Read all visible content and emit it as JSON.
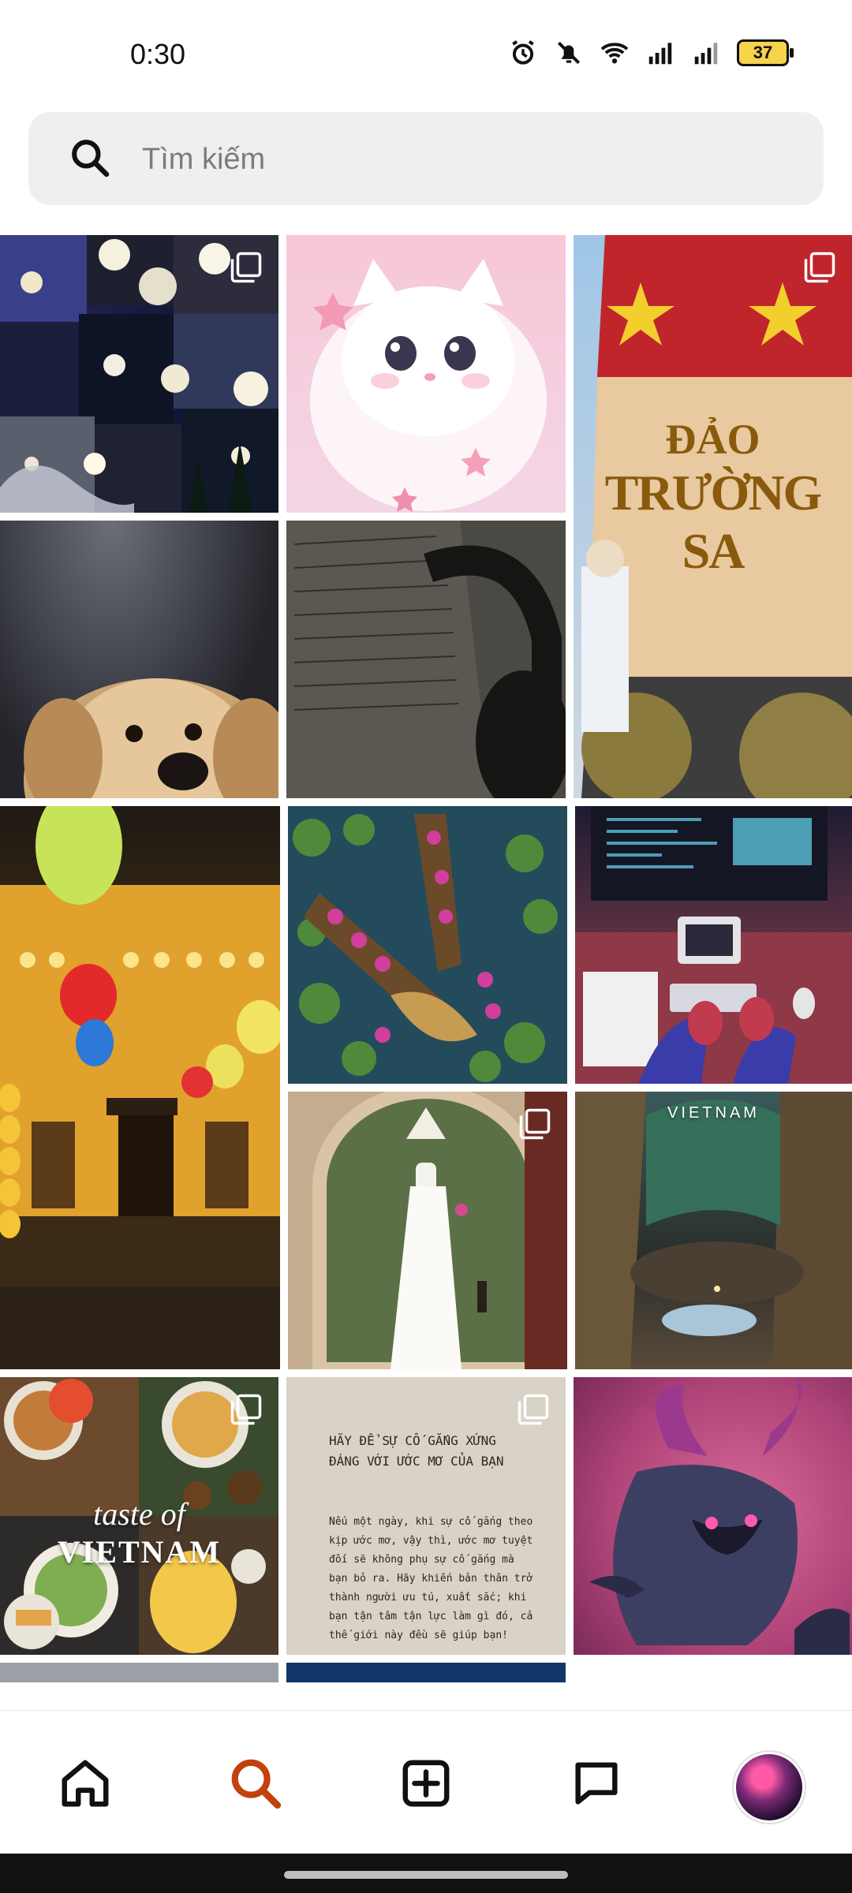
{
  "status": {
    "time": "0:30",
    "battery": "37",
    "icons": [
      "alarm-icon",
      "mute-icon",
      "wifi-icon",
      "signal-icon",
      "signal-icon-2",
      "battery-icon"
    ]
  },
  "search": {
    "placeholder": "Tìm kiếm",
    "icon": "search-icon"
  },
  "grid": {
    "tiles": [
      {
        "name": "moon-collage",
        "multi": true
      },
      {
        "name": "white-kitten-art",
        "multi": false
      },
      {
        "name": "truong-sa-monument",
        "multi": true,
        "text_main": "ĐẢO",
        "text_sub": "TRƯỜNG SA"
      },
      {
        "name": "golden-puppy",
        "multi": false
      },
      {
        "name": "book-headphones",
        "multi": false
      },
      {
        "name": "hoi-an-lanterns",
        "multi": false
      },
      {
        "name": "lotus-boats",
        "multi": false
      },
      {
        "name": "computer-desk",
        "multi": false
      },
      {
        "name": "ao-dai-arch",
        "multi": true
      },
      {
        "name": "vietnam-cave",
        "multi": false,
        "label": "VIETNAM"
      },
      {
        "name": "taste-of-vietnam",
        "multi": true,
        "label_script": "taste of",
        "label_main": "VIETNAM"
      },
      {
        "name": "quote-page",
        "multi": true,
        "heading": "HÃY ĐỂ SỰ CỐ GẮNG XỨNG ĐÁNG VỚI ƯỚC MƠ CỦA BẠN",
        "body": "Nếu một ngày, khi sự cố gắng theo kịp ước mơ, vậy thì, ước mơ tuyệt đối sẽ không phụ sự cố gắng mà bạn bỏ ra. Hãy khiến bản thân trở thành người ưu tú, xuất sắc; khi bạn tận tâm tận lực làm gì đó, cả thế giới này đều sẽ giúp bạn!"
      },
      {
        "name": "demon-art",
        "multi": false
      }
    ]
  },
  "nav": {
    "items": [
      {
        "name": "home",
        "icon": "home-icon"
      },
      {
        "name": "search",
        "icon": "search-icon",
        "active": true
      },
      {
        "name": "create",
        "icon": "add-square-icon"
      },
      {
        "name": "messages",
        "icon": "message-icon"
      },
      {
        "name": "profile",
        "icon": "avatar"
      }
    ],
    "active_color": "#c2410c"
  }
}
